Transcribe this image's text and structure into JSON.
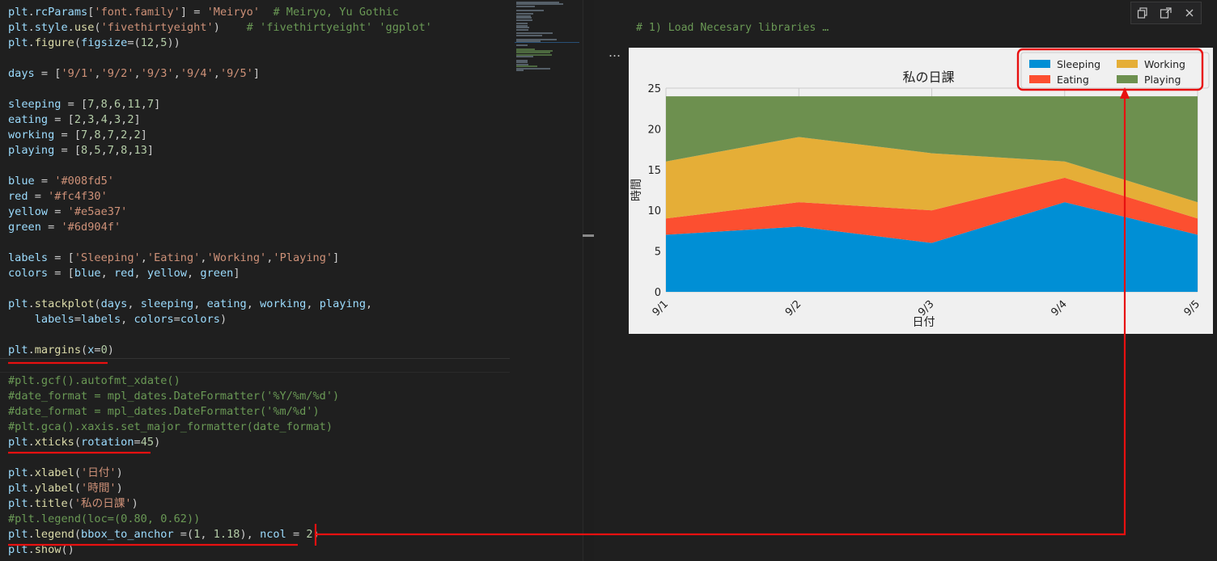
{
  "editor": {
    "lines": [
      [
        [
          "t-var",
          "plt"
        ],
        [
          "t-pun",
          "."
        ],
        [
          "t-var",
          "rcParams"
        ],
        [
          "t-pun",
          "["
        ],
        [
          "t-str",
          "'font.family'"
        ],
        [
          "t-pun",
          "] = "
        ],
        [
          "t-str",
          "'Meiryo'"
        ],
        [
          "t-pun",
          "  "
        ],
        [
          "t-com",
          "# Meiryo, Yu Gothic"
        ]
      ],
      [
        [
          "t-var",
          "plt"
        ],
        [
          "t-pun",
          "."
        ],
        [
          "t-var",
          "style"
        ],
        [
          "t-pun",
          "."
        ],
        [
          "t-fn",
          "use"
        ],
        [
          "t-pun",
          "("
        ],
        [
          "t-str",
          "'fivethirtyeight'"
        ],
        [
          "t-pun",
          ")    "
        ],
        [
          "t-com",
          "# 'fivethirtyeight' 'ggplot'"
        ]
      ],
      [
        [
          "t-var",
          "plt"
        ],
        [
          "t-pun",
          "."
        ],
        [
          "t-fn",
          "figure"
        ],
        [
          "t-pun",
          "("
        ],
        [
          "t-var",
          "figsize"
        ],
        [
          "t-pun",
          "=("
        ],
        [
          "t-num",
          "12"
        ],
        [
          "t-pun",
          ","
        ],
        [
          "t-num",
          "5"
        ],
        [
          "t-pun",
          "))"
        ]
      ],
      [],
      [
        [
          "t-var",
          "days"
        ],
        [
          "t-pun",
          " = ["
        ],
        [
          "t-str",
          "'9/1'"
        ],
        [
          "t-pun",
          ","
        ],
        [
          "t-str",
          "'9/2'"
        ],
        [
          "t-pun",
          ","
        ],
        [
          "t-str",
          "'9/3'"
        ],
        [
          "t-pun",
          ","
        ],
        [
          "t-str",
          "'9/4'"
        ],
        [
          "t-pun",
          ","
        ],
        [
          "t-str",
          "'9/5'"
        ],
        [
          "t-pun",
          "]"
        ]
      ],
      [],
      [
        [
          "t-var",
          "sleeping"
        ],
        [
          "t-pun",
          " = ["
        ],
        [
          "t-num",
          "7"
        ],
        [
          "t-pun",
          ","
        ],
        [
          "t-num",
          "8"
        ],
        [
          "t-pun",
          ","
        ],
        [
          "t-num",
          "6"
        ],
        [
          "t-pun",
          ","
        ],
        [
          "t-num",
          "11"
        ],
        [
          "t-pun",
          ","
        ],
        [
          "t-num",
          "7"
        ],
        [
          "t-pun",
          "]"
        ]
      ],
      [
        [
          "t-var",
          "eating"
        ],
        [
          "t-pun",
          " = ["
        ],
        [
          "t-num",
          "2"
        ],
        [
          "t-pun",
          ","
        ],
        [
          "t-num",
          "3"
        ],
        [
          "t-pun",
          ","
        ],
        [
          "t-num",
          "4"
        ],
        [
          "t-pun",
          ","
        ],
        [
          "t-num",
          "3"
        ],
        [
          "t-pun",
          ","
        ],
        [
          "t-num",
          "2"
        ],
        [
          "t-pun",
          "]"
        ]
      ],
      [
        [
          "t-var",
          "working"
        ],
        [
          "t-pun",
          " = ["
        ],
        [
          "t-num",
          "7"
        ],
        [
          "t-pun",
          ","
        ],
        [
          "t-num",
          "8"
        ],
        [
          "t-pun",
          ","
        ],
        [
          "t-num",
          "7"
        ],
        [
          "t-pun",
          ","
        ],
        [
          "t-num",
          "2"
        ],
        [
          "t-pun",
          ","
        ],
        [
          "t-num",
          "2"
        ],
        [
          "t-pun",
          "]"
        ]
      ],
      [
        [
          "t-var",
          "playing"
        ],
        [
          "t-pun",
          " = ["
        ],
        [
          "t-num",
          "8"
        ],
        [
          "t-pun",
          ","
        ],
        [
          "t-num",
          "5"
        ],
        [
          "t-pun",
          ","
        ],
        [
          "t-num",
          "7"
        ],
        [
          "t-pun",
          ","
        ],
        [
          "t-num",
          "8"
        ],
        [
          "t-pun",
          ","
        ],
        [
          "t-num",
          "13"
        ],
        [
          "t-pun",
          "]"
        ]
      ],
      [],
      [
        [
          "t-var",
          "blue"
        ],
        [
          "t-pun",
          " = "
        ],
        [
          "t-str",
          "'#008fd5'"
        ]
      ],
      [
        [
          "t-var",
          "red"
        ],
        [
          "t-pun",
          " = "
        ],
        [
          "t-str",
          "'#fc4f30'"
        ]
      ],
      [
        [
          "t-var",
          "yellow"
        ],
        [
          "t-pun",
          " = "
        ],
        [
          "t-str",
          "'#e5ae37'"
        ]
      ],
      [
        [
          "t-var",
          "green"
        ],
        [
          "t-pun",
          " = "
        ],
        [
          "t-str",
          "'#6d904f'"
        ]
      ],
      [],
      [
        [
          "t-var",
          "labels"
        ],
        [
          "t-pun",
          " = ["
        ],
        [
          "t-str",
          "'Sleeping'"
        ],
        [
          "t-pun",
          ","
        ],
        [
          "t-str",
          "'Eating'"
        ],
        [
          "t-pun",
          ","
        ],
        [
          "t-str",
          "'Working'"
        ],
        [
          "t-pun",
          ","
        ],
        [
          "t-str",
          "'Playing'"
        ],
        [
          "t-pun",
          "]"
        ]
      ],
      [
        [
          "t-var",
          "colors"
        ],
        [
          "t-pun",
          " = ["
        ],
        [
          "t-var",
          "blue"
        ],
        [
          "t-pun",
          ", "
        ],
        [
          "t-var",
          "red"
        ],
        [
          "t-pun",
          ", "
        ],
        [
          "t-var",
          "yellow"
        ],
        [
          "t-pun",
          ", "
        ],
        [
          "t-var",
          "green"
        ],
        [
          "t-pun",
          "]"
        ]
      ],
      [],
      [
        [
          "t-var",
          "plt"
        ],
        [
          "t-pun",
          "."
        ],
        [
          "t-fn",
          "stackplot"
        ],
        [
          "t-pun",
          "("
        ],
        [
          "t-var",
          "days"
        ],
        [
          "t-pun",
          ", "
        ],
        [
          "t-var",
          "sleeping"
        ],
        [
          "t-pun",
          ", "
        ],
        [
          "t-var",
          "eating"
        ],
        [
          "t-pun",
          ", "
        ],
        [
          "t-var",
          "working"
        ],
        [
          "t-pun",
          ", "
        ],
        [
          "t-var",
          "playing"
        ],
        [
          "t-pun",
          ","
        ]
      ],
      [
        [
          "t-pun",
          "    "
        ],
        [
          "t-var",
          "labels"
        ],
        [
          "t-pun",
          "="
        ],
        [
          "t-var",
          "labels"
        ],
        [
          "t-pun",
          ", "
        ],
        [
          "t-var",
          "colors"
        ],
        [
          "t-pun",
          "="
        ],
        [
          "t-var",
          "colors"
        ],
        [
          "t-pun",
          ")"
        ]
      ],
      [],
      [
        [
          "t-var",
          "plt"
        ],
        [
          "t-pun",
          "."
        ],
        [
          "t-fn",
          "margins"
        ],
        [
          "t-pun",
          "("
        ],
        [
          "t-var",
          "x"
        ],
        [
          "t-pun",
          "="
        ],
        [
          "t-num",
          "0"
        ],
        [
          "t-pun",
          ")"
        ]
      ],
      [],
      [
        [
          "t-com",
          "#plt.gcf().autofmt_xdate()"
        ]
      ],
      [
        [
          "t-com",
          "#date_format = mpl_dates.DateFormatter('%Y/%m/%d')"
        ]
      ],
      [
        [
          "t-com",
          "#date_format = mpl_dates.DateFormatter('%m/%d')"
        ]
      ],
      [
        [
          "t-com",
          "#plt.gca().xaxis.set_major_formatter(date_format)"
        ]
      ],
      [
        [
          "t-var",
          "plt"
        ],
        [
          "t-pun",
          "."
        ],
        [
          "t-fn",
          "xticks"
        ],
        [
          "t-pun",
          "("
        ],
        [
          "t-var",
          "rotation"
        ],
        [
          "t-pun",
          "="
        ],
        [
          "t-num",
          "45"
        ],
        [
          "t-pun",
          ")"
        ]
      ],
      [],
      [
        [
          "t-var",
          "plt"
        ],
        [
          "t-pun",
          "."
        ],
        [
          "t-fn",
          "xlabel"
        ],
        [
          "t-pun",
          "("
        ],
        [
          "t-str",
          "'日付'"
        ],
        [
          "t-pun",
          ")"
        ]
      ],
      [
        [
          "t-var",
          "plt"
        ],
        [
          "t-pun",
          "."
        ],
        [
          "t-fn",
          "ylabel"
        ],
        [
          "t-pun",
          "("
        ],
        [
          "t-str",
          "'時間'"
        ],
        [
          "t-pun",
          ")"
        ]
      ],
      [
        [
          "t-var",
          "plt"
        ],
        [
          "t-pun",
          "."
        ],
        [
          "t-fn",
          "title"
        ],
        [
          "t-pun",
          "("
        ],
        [
          "t-str",
          "'私の日課'"
        ],
        [
          "t-pun",
          ")"
        ]
      ],
      [
        [
          "t-com",
          "#plt.legend(loc=(0.80, 0.62))"
        ]
      ],
      [
        [
          "t-var",
          "plt"
        ],
        [
          "t-pun",
          "."
        ],
        [
          "t-fn",
          "legend"
        ],
        [
          "t-pun",
          "("
        ],
        [
          "t-var",
          "bbox_to_anchor"
        ],
        [
          "t-pun",
          " =("
        ],
        [
          "t-num",
          "1"
        ],
        [
          "t-pun",
          ", "
        ],
        [
          "t-num",
          "1.18"
        ],
        [
          "t-pun",
          "), "
        ],
        [
          "t-var",
          "ncol"
        ],
        [
          "t-pun",
          " = "
        ],
        [
          "t-num",
          "2"
        ],
        [
          "t-pun",
          ")"
        ]
      ],
      [
        [
          "t-var",
          "plt"
        ],
        [
          "t-pun",
          "."
        ],
        [
          "t-fn",
          "show"
        ],
        [
          "t-pun",
          "()"
        ]
      ]
    ]
  },
  "output": {
    "collapsed_code": "# 1) Load Necesary libraries …",
    "ellipsis": "…",
    "toolbar": {
      "copy_icon": "copy-icon",
      "open_icon": "open-output-icon",
      "close_icon": "close-icon"
    }
  },
  "chart_data": {
    "type": "area",
    "stacked": true,
    "title": "私の日課",
    "xlabel": "日付",
    "ylabel": "時間",
    "categories": [
      "9/1",
      "9/2",
      "9/3",
      "9/4",
      "9/5"
    ],
    "ylim": [
      0,
      25
    ],
    "yticks": [
      0,
      5,
      10,
      15,
      20,
      25
    ],
    "grid": true,
    "legend_placement": "top-right",
    "legend_columns": 2,
    "series": [
      {
        "name": "Sleeping",
        "values": [
          7,
          8,
          6,
          11,
          7
        ],
        "color": "#008fd5"
      },
      {
        "name": "Eating",
        "values": [
          2,
          3,
          4,
          3,
          2
        ],
        "color": "#fc4f30"
      },
      {
        "name": "Working",
        "values": [
          7,
          8,
          7,
          2,
          2
        ],
        "color": "#e5ae37"
      },
      {
        "name": "Playing",
        "values": [
          8,
          5,
          7,
          8,
          13
        ],
        "color": "#6d904f"
      }
    ]
  },
  "annotation_color": "#e81010"
}
